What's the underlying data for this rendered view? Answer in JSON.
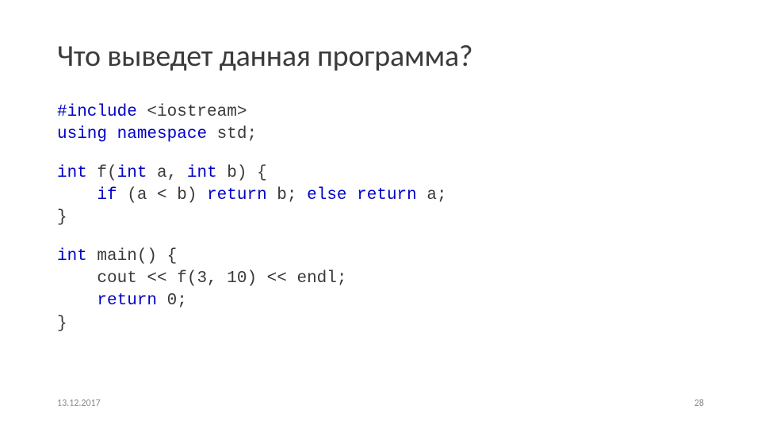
{
  "title": "Что выведет данная программа?",
  "code": {
    "block1": {
      "l1": {
        "pre": "#include ",
        "inc": "<iostream>"
      },
      "l2": {
        "a": "using",
        "b": " ",
        "c": "namespace",
        "d": " std;"
      }
    },
    "block2": {
      "l1": {
        "a": "int",
        "b": " f(",
        "c": "int",
        "d": " a, ",
        "e": "int",
        "f": " b) {"
      },
      "l2": {
        "indent": "    ",
        "a": "if",
        "b": " (a < b) ",
        "c": "return",
        "d": " b; ",
        "e": "else",
        "f": " ",
        "g": "return",
        "h": " a;"
      },
      "l3": "}"
    },
    "block3": {
      "l1": {
        "a": "int",
        "b": " main() {"
      },
      "l2": {
        "indent": "    ",
        "a": "cout << f(3, 10) << endl;"
      },
      "l3": {
        "indent": "    ",
        "a": "return",
        "b": " 0;"
      },
      "l4": "}"
    }
  },
  "footer": {
    "date": "13.12.2017",
    "page": "28"
  }
}
